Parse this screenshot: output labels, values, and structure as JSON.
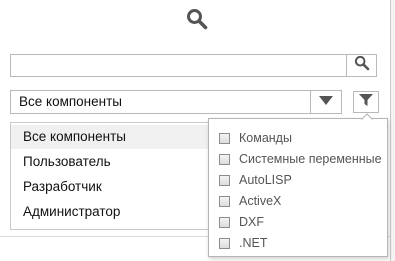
{
  "icons": {
    "header_search": "search-icon",
    "search_button": "search-icon",
    "combo_arrow": "triangle-down-icon",
    "filter": "filter-icon"
  },
  "colors": {
    "icon_gray": "#555555",
    "border": "#b9b9b9",
    "selected_row": "#f0f0f0",
    "filter_label": "#555555"
  },
  "search": {
    "value": "",
    "placeholder": ""
  },
  "combo": {
    "selected": "Все компоненты"
  },
  "list": {
    "items": [
      {
        "label": "Все компоненты",
        "selected": true
      },
      {
        "label": "Пользователь",
        "selected": false
      },
      {
        "label": "Разработчик",
        "selected": false
      },
      {
        "label": "Администратор",
        "selected": false
      }
    ]
  },
  "filter_popup": {
    "items": [
      {
        "label": "Команды",
        "checked": false
      },
      {
        "label": "Системные переменные",
        "checked": false
      },
      {
        "label": "AutoLISP",
        "checked": false
      },
      {
        "label": "ActiveX",
        "checked": false
      },
      {
        "label": "DXF",
        "checked": false
      },
      {
        "label": ".NET",
        "checked": false
      }
    ]
  }
}
